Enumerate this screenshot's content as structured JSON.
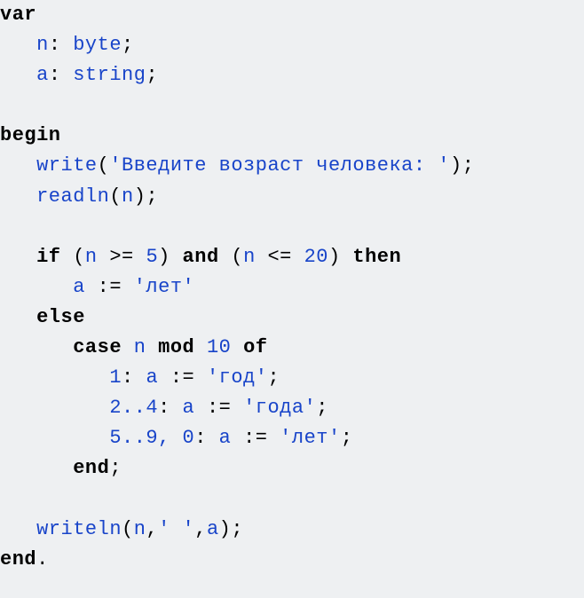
{
  "code": {
    "kw_var": "var",
    "decl_n_name": "n",
    "decl_n_type": "byte",
    "decl_a_name": "a",
    "decl_a_type": "string",
    "kw_begin": "begin",
    "fn_write": "write",
    "str_prompt": "'Введите возраст человека: '",
    "fn_readln": "readln",
    "arg_readln": "n",
    "kw_if": "if",
    "cond_lhs_var": "n",
    "op_ge": ">=",
    "num_5": "5",
    "kw_and": "and",
    "cond_rhs_var": "n",
    "op_le": "<=",
    "num_20": "20",
    "kw_then": "then",
    "assign_a1_target": "a",
    "op_assign": ":=",
    "str_let1": "'лет'",
    "kw_else": "else",
    "kw_case": "case",
    "case_expr_var": "n",
    "kw_mod": "mod",
    "num_10": "10",
    "kw_of": "of",
    "case1_label": "1",
    "case1_target": "a",
    "case1_value": "'год'",
    "case2_label": "2..4",
    "case2_target": "a",
    "case2_value": "'года'",
    "case3_label": "5..9, 0",
    "case3_target": "a",
    "case3_value": "'лет'",
    "kw_end1": "end",
    "fn_writeln": "writeln",
    "writeln_arg1": "n",
    "writeln_arg2": "' '",
    "writeln_arg3": "a",
    "kw_end2": "end",
    "colon": ":",
    "semicolon": ";",
    "lparen": "(",
    "rparen": ")",
    "comma": ",",
    "dot": "."
  }
}
